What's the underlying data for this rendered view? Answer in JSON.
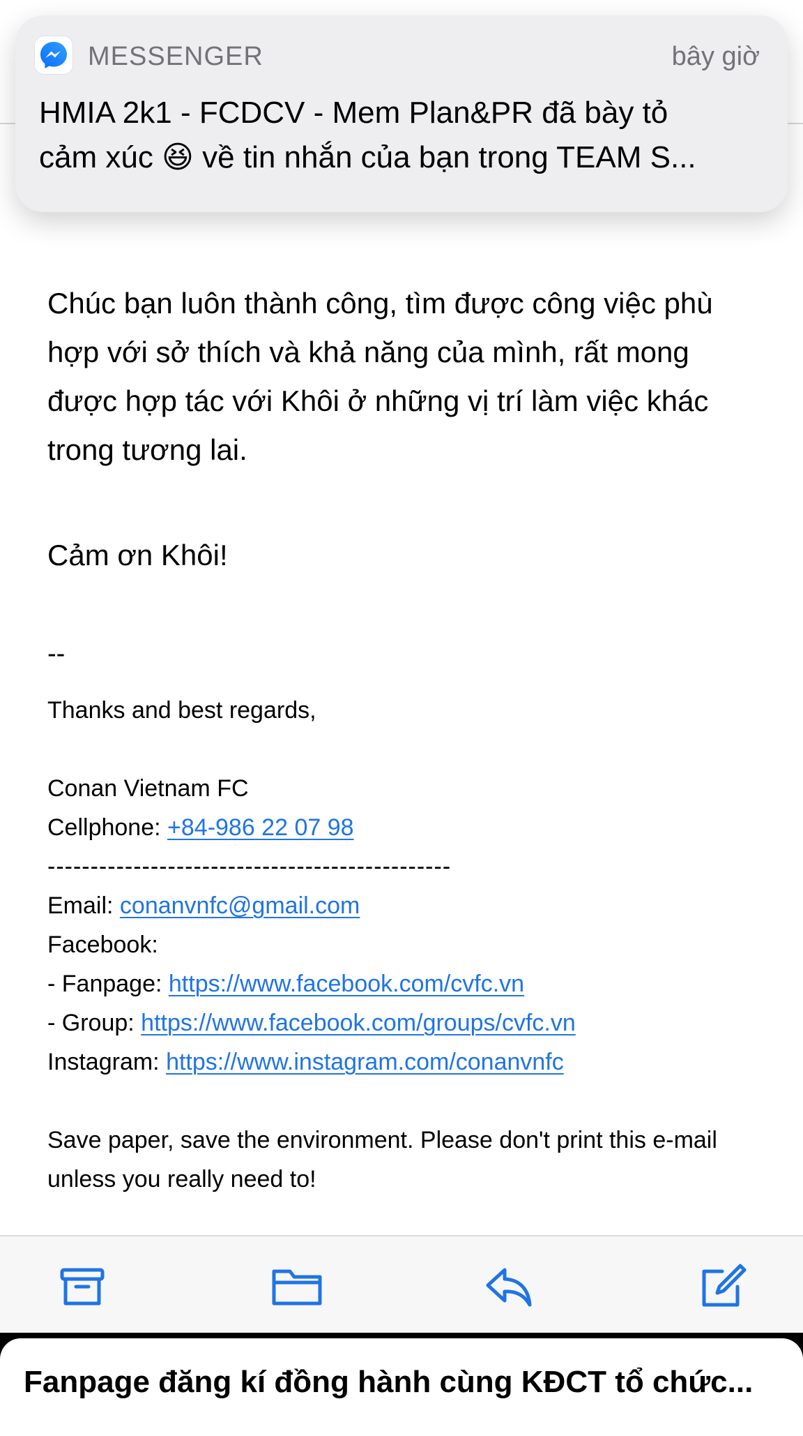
{
  "notification": {
    "app_name": "MESSENGER",
    "time": "bây giờ",
    "message_line1": "HMIA 2k1 - FCDCV - Mem Plan&PR đã bày tỏ",
    "message_line2_pre": "cảm xúc ",
    "message_emoji": "😆",
    "message_line2_post": " về tin nhắn của bạn trong TEAM S...",
    "icon": "messenger-icon",
    "accent_color": "#0a7cff"
  },
  "email": {
    "clipped_line": "— — — — —",
    "body_paragraph": "Chúc bạn luôn thành công, tìm được công việc phù hợp với sở thích và khả năng của mình, rất mong được hợp tác với Khôi ở những vị trí làm việc khác trong tương lai.",
    "thanks": "Cảm ơn Khôi!",
    "signature": {
      "dashes": "--",
      "regards": "Thanks and best regards,",
      "org": "Conan Vietnam FC",
      "cellphone_label": "Cellphone: ",
      "cellphone": "+84-986 22 07 98",
      "separator": "-----------------------------------------------",
      "email_label": "Email: ",
      "email": "conanvnfc@gmail.com",
      "facebook_label": "Facebook:",
      "fanpage_label": "- Fanpage: ",
      "fanpage_url": "https://www.facebook.com/cvfc.vn",
      "group_label": "- Group: ",
      "group_url": "https://www.facebook.com/groups/cvfc.vn",
      "instagram_label": "Instagram: ",
      "instagram_url": "https://www.instagram.com/conanvnfc",
      "save_paper": "Save paper, save the environment. Please don't print this e-mail unless you really need to!"
    },
    "link_color": "#1f74e5"
  },
  "toolbar": {
    "icons": [
      "archive-icon",
      "folder-icon",
      "reply-icon",
      "compose-icon"
    ],
    "icon_color": "#1f74e5"
  },
  "bottom_sheet": {
    "title": "Fanpage đăng kí đồng hành cùng KĐCT tổ chức..."
  }
}
